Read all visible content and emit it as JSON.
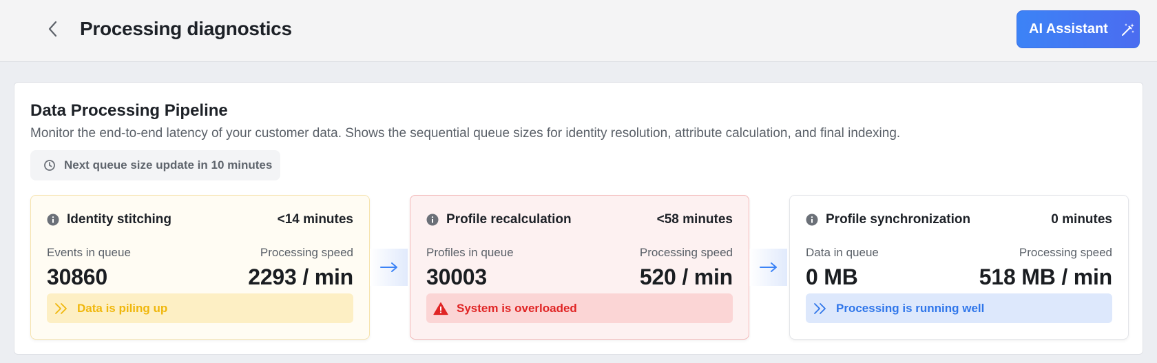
{
  "header": {
    "title": "Processing diagnostics",
    "ai_button_label": "AI Assistant"
  },
  "pipeline": {
    "title": "Data Processing Pipeline",
    "description": "Monitor the end-to-end latency of your customer data. Shows the sequential queue sizes for identity resolution, attribute calculation, and final indexing.",
    "next_update": "Next queue size update in 10 minutes",
    "stages": [
      {
        "title": "Identity stitching",
        "duration": "<14 minutes",
        "queue_label": "Events in queue",
        "queue_value": "30860",
        "speed_label": "Processing speed",
        "speed_value": "2293 / min",
        "status_text": "Data is piling up",
        "status_icon": "double-chevron-right-icon",
        "status_color": "#f0b70c"
      },
      {
        "title": "Profile recalculation",
        "duration": "<58 minutes",
        "queue_label": "Profiles in queue",
        "queue_value": "30003",
        "speed_label": "Processing speed",
        "speed_value": "520 / min",
        "status_text": "System is overloaded",
        "status_icon": "warning-triangle-icon",
        "status_color": "#e02424"
      },
      {
        "title": "Profile synchronization",
        "duration": "0 minutes",
        "queue_label": "Data in queue",
        "queue_value": "0 MB",
        "speed_label": "Processing speed",
        "speed_value": "518 MB / min",
        "status_text": "Processing is running well",
        "status_icon": "double-chevron-right-icon",
        "status_color": "#2f76ea"
      }
    ]
  },
  "colors": {
    "accent": "#3c83f6",
    "warning": "#f0b70c",
    "error": "#e02424",
    "info": "#2f76ea"
  }
}
